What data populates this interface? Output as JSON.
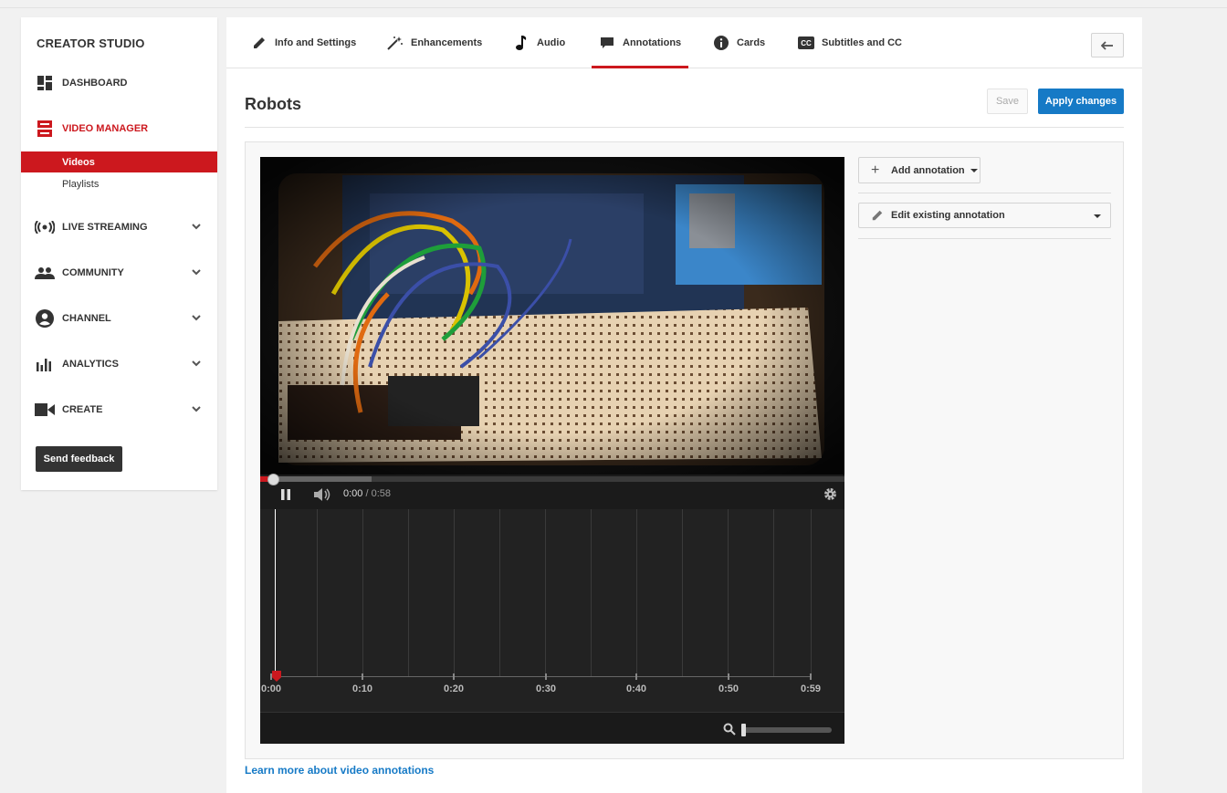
{
  "sidebar": {
    "title": "CREATOR STUDIO",
    "items": {
      "dashboard": "DASHBOARD",
      "video_manager": "VIDEO MANAGER",
      "videos": "Videos",
      "playlists": "Playlists",
      "live_streaming": "LIVE STREAMING",
      "community": "COMMUNITY",
      "channel": "CHANNEL",
      "analytics": "ANALYTICS",
      "create": "CREATE"
    },
    "feedback": "Send feedback"
  },
  "tabs": {
    "info": "Info and Settings",
    "enhancements": "Enhancements",
    "audio": "Audio",
    "annotations": "Annotations",
    "cards": "Cards",
    "subtitles": "Subtitles and CC",
    "active": "Annotations"
  },
  "page": {
    "title": "Robots",
    "save": "Save",
    "apply": "Apply changes",
    "learn_more": "Learn more about video annotations"
  },
  "player": {
    "current_time": "0:00",
    "separator": " / ",
    "duration": "0:58",
    "state": "playing",
    "played_fraction": 0.02,
    "buffered_fraction": 0.19
  },
  "timeline": {
    "labels": [
      "0:00",
      "0:10",
      "0:20",
      "0:30",
      "0:40",
      "0:50",
      "0:59"
    ]
  },
  "annotations_panel": {
    "add": "Add annotation",
    "edit": "Edit existing annotation"
  },
  "colors": {
    "accent_red": "#cc181e",
    "primary_blue": "#167ac6"
  },
  "icons": [
    "dashboard-icon",
    "video-manager-icon",
    "live-icon",
    "community-icon",
    "channel-icon",
    "analytics-icon",
    "create-icon",
    "pencil-icon",
    "wand-icon",
    "music-icon",
    "speech-bubble-icon",
    "info-icon",
    "cc-icon",
    "back-arrow-icon",
    "pause-icon",
    "volume-icon",
    "gear-icon",
    "zoom-icon",
    "plus-icon"
  ]
}
